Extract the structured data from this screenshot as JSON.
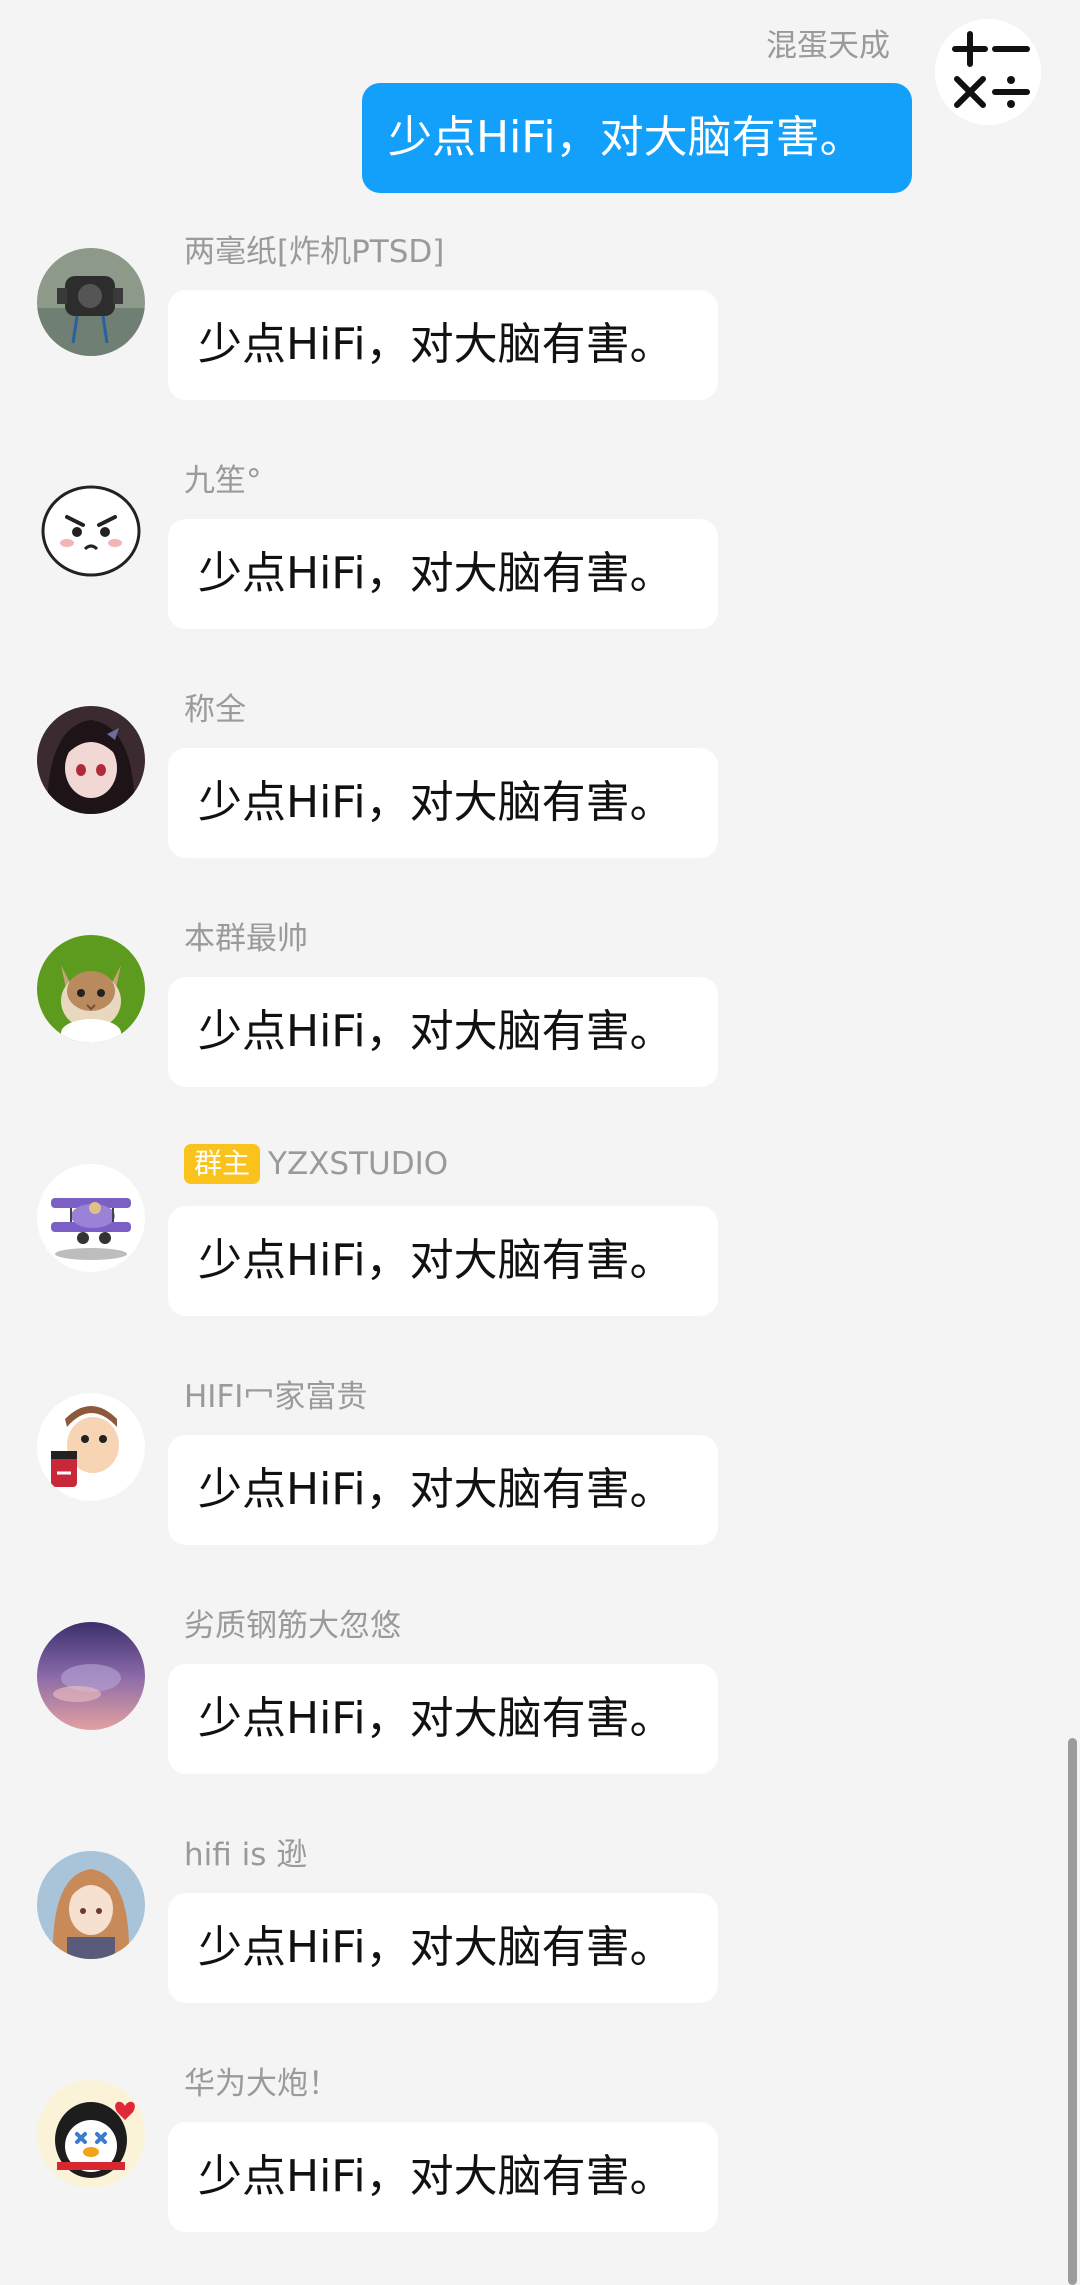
{
  "outgoing": {
    "sender": "混蛋天成",
    "text": "少点HiFi，对大脑有害。",
    "avatar_icon": "calculator-symbols-icon"
  },
  "messages": [
    {
      "sender": "两毫纸[炸机PTSD]",
      "text": "少点HiFi，对大脑有害。",
      "avatar_icon": "motor-photo-avatar",
      "badge": ""
    },
    {
      "sender": "九笙°",
      "text": "少点HiFi，对大脑有害。",
      "avatar_icon": "angry-cartoon-face-avatar",
      "badge": ""
    },
    {
      "sender": "称全",
      "text": "少点HiFi，对大脑有害。",
      "avatar_icon": "anime-girl-avatar",
      "badge": ""
    },
    {
      "sender": "本群最帅",
      "text": "少点HiFi，对大脑有害。",
      "avatar_icon": "cat-avatar",
      "badge": ""
    },
    {
      "sender": "YZXSTUDIO",
      "text": "少点HiFi，对大脑有害。",
      "avatar_icon": "biplane-avatar",
      "badge": "群主"
    },
    {
      "sender": "HIFI⼍家富贵",
      "text": "少点HiFi，对大脑有害。",
      "avatar_icon": "cartoon-man-drinking-avatar",
      "badge": ""
    },
    {
      "sender": "劣质钢筋大忽悠",
      "text": "少点HiFi，对大脑有害。",
      "avatar_icon": "purple-sky-avatar",
      "badge": ""
    },
    {
      "sender": "hifi is 逊",
      "text": "少点HiFi，对大脑有害。",
      "avatar_icon": "anime-girl-brown-hair-avatar",
      "badge": ""
    },
    {
      "sender": "华为大炮！",
      "text": "少点HiFi，对大脑有害。",
      "avatar_icon": "penguin-avatar",
      "badge": ""
    }
  ],
  "colors": {
    "background": "#f4f4f4",
    "outgoing_bubble": "#12a0fa",
    "incoming_bubble": "#ffffff",
    "badge": "#f9c21c",
    "sender_name": "#9a9a9a"
  }
}
